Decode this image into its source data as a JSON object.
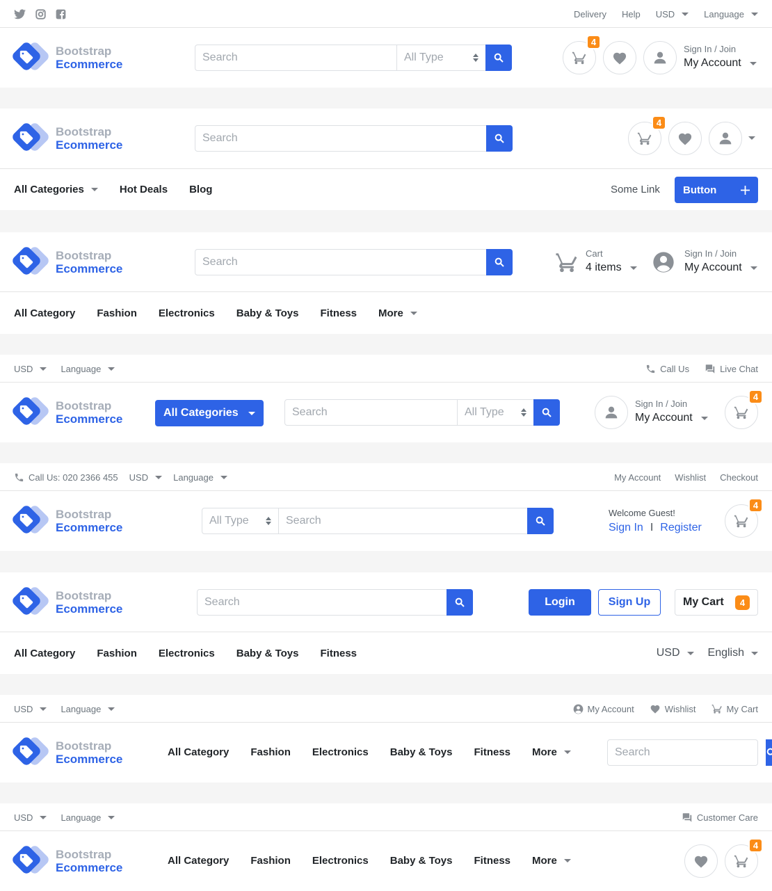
{
  "colors": {
    "primary": "#2e63e6",
    "badge": "#fb8c17",
    "muted": "#6c757d"
  },
  "logo": {
    "line1": "Bootstrap",
    "line2": "Ecommerce"
  },
  "search": {
    "placeholder": "Search",
    "type": "All Type"
  },
  "cart_count": "4",
  "header1": {
    "social": [
      "twitter-icon",
      "instagram-icon",
      "facebook-icon"
    ],
    "top_links": [
      "Delivery",
      "Help"
    ],
    "currency": "USD",
    "language": "Language",
    "account_top": "Sign In / Join",
    "account_bottom": "My Account"
  },
  "header2": {
    "nav": [
      "All Categories",
      "Hot Deals",
      "Blog"
    ],
    "right_link": "Some Link",
    "button": "Button"
  },
  "header3": {
    "cart_label": "Cart",
    "cart_items": "4 items",
    "account_top": "Sign In / Join",
    "account_bottom": "My Account",
    "nav": [
      "All Category",
      "Fashion",
      "Electronics",
      "Baby & Toys",
      "Fitness",
      "More"
    ]
  },
  "header4": {
    "currency": "USD",
    "language": "Language",
    "call": "Call Us",
    "chat": "Live Chat",
    "categories_button": "All Categories",
    "account_top": "Sign In / Join",
    "account_bottom": "My Account"
  },
  "header5": {
    "call": "Call Us: 020 2366 455",
    "currency": "USD",
    "language": "Language",
    "links": [
      "My Account",
      "Wishlist",
      "Checkout"
    ],
    "welcome": "Welcome Guest!",
    "signin": "Sign In",
    "sep": "I",
    "register": "Register"
  },
  "header6": {
    "login": "Login",
    "signup": "Sign Up",
    "cart": "My Cart",
    "nav": [
      "All Category",
      "Fashion",
      "Electronics",
      "Baby & Toys",
      "Fitness"
    ],
    "currency": "USD",
    "language": "English"
  },
  "header7": {
    "currency": "USD",
    "language": "Language",
    "account": "My Account",
    "wishlist": "Wishlist",
    "cart": "My Cart",
    "nav": [
      "All Category",
      "Fashion",
      "Electronics",
      "Baby & Toys",
      "Fitness",
      "More"
    ]
  },
  "header8": {
    "currency": "USD",
    "language": "Language",
    "care": "Customer Care",
    "nav": [
      "All Category",
      "Fashion",
      "Electronics",
      "Baby & Toys",
      "Fitness",
      "More"
    ]
  }
}
